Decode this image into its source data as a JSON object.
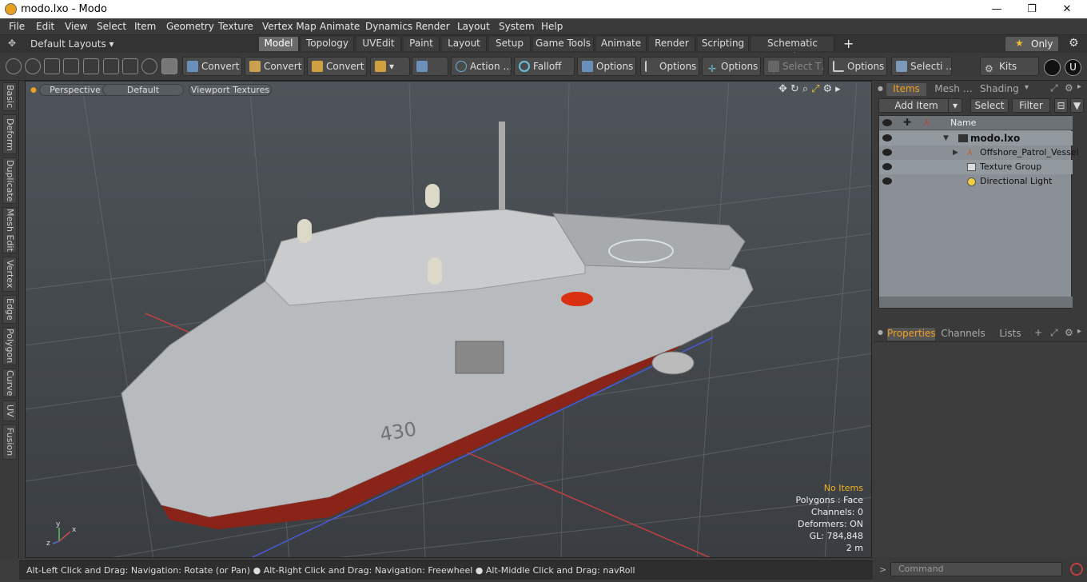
{
  "window": {
    "title": "modo.lxo - Modo",
    "minimize": "—",
    "maximize": "❐",
    "close": "✕"
  },
  "menu": [
    "File",
    "Edit",
    "View",
    "Select",
    "Item",
    "Geometry",
    "Texture",
    "Vertex Map",
    "Animate",
    "Dynamics",
    "Render",
    "Layout",
    "System",
    "Help"
  ],
  "layouts_label": "Default Layouts ▾",
  "mode_tabs": [
    "Model",
    "Topology",
    "UVEdit",
    "Paint",
    "Layout",
    "Setup",
    "Game Tools",
    "Animate",
    "Render",
    "Scripting",
    "Schematic Fusion"
  ],
  "active_mode_tab": "Model",
  "add_tab": "+",
  "only_label": "Only",
  "only_star": "★",
  "toolbar": {
    "convert1": "Convert",
    "convert2": "Convert",
    "convert3": "Convert",
    "action": "Action …",
    "falloff": "Falloff",
    "options1": "Options",
    "options2": "Options",
    "options3": "Options",
    "select_t": "Select T…",
    "options4": "Options",
    "selecti": "Selecti …",
    "kits": "Kits"
  },
  "left_tabs": [
    "Basic",
    "Deform",
    "Duplicate",
    "Mesh Edit",
    "Vertex",
    "Edge",
    "Polygon",
    "Curve",
    "UV",
    "Fusion"
  ],
  "viewport": {
    "perspective": "Perspective",
    "default": "Default",
    "textures": "Viewport Textures",
    "hull_number": "430",
    "info": {
      "no_items": "No Items",
      "polygons": "Polygons : Face",
      "channels": "Channels: 0",
      "deformers": "Deformers: ON",
      "gl": "GL: 784,848",
      "scale": "2 m"
    },
    "axis_x": "x",
    "axis_y": "y",
    "axis_z": "z"
  },
  "status": "Alt-Left Click and Drag: Navigation: Rotate (or Pan) ● Alt-Right Click and Drag: Navigation: Freewheel ● Alt-Middle Click and Drag: navRoll",
  "right_panel": {
    "tabs": [
      "Items",
      "Mesh …",
      "Shading"
    ],
    "add_item": "Add Item",
    "select": "Select",
    "filter": "Filter",
    "col_name": "Name",
    "items": [
      {
        "name": "modo.lxo"
      },
      {
        "name": "Offshore_Patrol_Vessel"
      },
      {
        "name": "Texture Group"
      },
      {
        "name": "Directional Light"
      }
    ],
    "lower_tabs": [
      "Properties",
      "Channels",
      "Lists"
    ],
    "command_placeholder": "Command"
  },
  "colors": {
    "accent": "#f0a020",
    "hull_red": "#8a2418",
    "hull_gray": "#b8bbbd"
  }
}
